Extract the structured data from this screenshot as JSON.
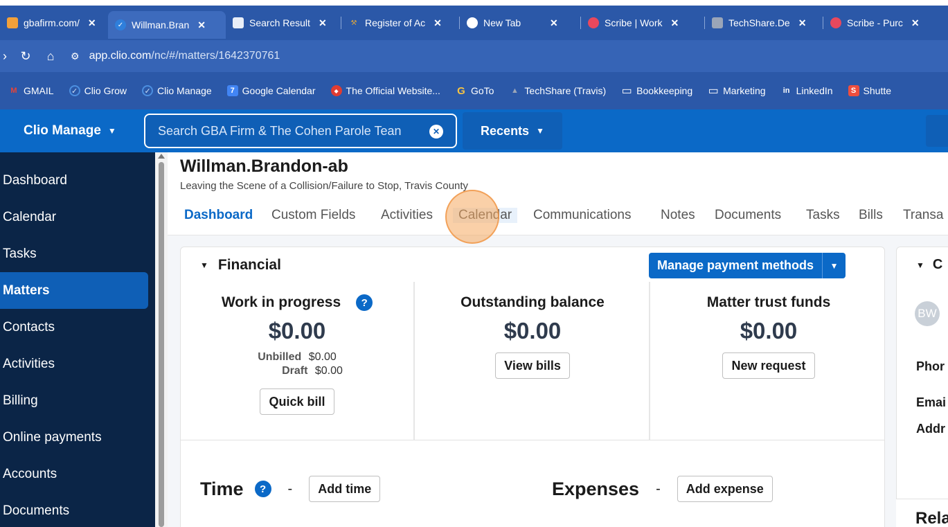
{
  "browser": {
    "tabs": [
      {
        "label": "gbafirm.com/",
        "icon": "generic-favicon",
        "color": "#f2a03a"
      },
      {
        "label": "Willman.Bran",
        "icon": "clio-favicon",
        "color": "#2f7fdb",
        "active": true
      },
      {
        "label": "Search Result",
        "icon": "document-favicon",
        "color": "#e8eef8"
      },
      {
        "label": "Register of Ac",
        "icon": "register-favicon",
        "color": "#d9a441"
      },
      {
        "label": "New Tab",
        "icon": "chrome-icon",
        "color": "#ffffff"
      },
      {
        "label": "Scribe | Work",
        "icon": "scribe-icon",
        "color": "#e8485d"
      },
      {
        "label": "TechShare.De",
        "icon": "courthouse-icon",
        "color": "#9aa5b8"
      },
      {
        "label": "Scribe - Purc",
        "icon": "scribe-icon",
        "color": "#e8485d"
      }
    ],
    "close_glyph": "✕",
    "url_site": "app.clio.com",
    "url_path": "/nc/#/matters/1642370761",
    "bookmarks": [
      {
        "label": "GMAIL",
        "icon": "gmail-icon",
        "glyph": "M",
        "color": "#ea4335"
      },
      {
        "label": "Clio Grow",
        "icon": "clio-grow-icon",
        "glyph": "✓",
        "color": "#4c8fe0"
      },
      {
        "label": "Clio Manage",
        "icon": "clio-manage-icon",
        "glyph": "✓",
        "color": "#4c8fe0"
      },
      {
        "label": "Google Calendar",
        "icon": "google-calendar-icon",
        "glyph": "7",
        "color": "#4285f4"
      },
      {
        "label": "The Official Website...",
        "icon": "official-website-icon",
        "glyph": "◆",
        "color": "#e03c31"
      },
      {
        "label": "GoTo",
        "icon": "goto-icon",
        "glyph": "G",
        "color": "#f6c343"
      },
      {
        "label": "TechShare (Travis)",
        "icon": "courthouse-icon",
        "glyph": "▲",
        "color": "#9aa5b8"
      },
      {
        "label": "Bookkeeping",
        "icon": "folder-icon",
        "glyph": "▭",
        "color": "transparent"
      },
      {
        "label": "Marketing",
        "icon": "folder-icon",
        "glyph": "▭",
        "color": "transparent"
      },
      {
        "label": "LinkedIn",
        "icon": "linkedin-icon",
        "glyph": "in",
        "color": "transparent"
      },
      {
        "label": "Shutte",
        "icon": "shutterstock-icon",
        "glyph": "S",
        "color": "#ee4e3e"
      }
    ]
  },
  "header": {
    "brand": "Clio Manage",
    "search_placeholder": "Search GBA Firm & The Cohen Parole Tean",
    "recents": "Recents"
  },
  "sidebar": {
    "items": [
      {
        "label": "Dashboard"
      },
      {
        "label": "Calendar"
      },
      {
        "label": "Tasks"
      },
      {
        "label": "Matters",
        "active": true
      },
      {
        "label": "Contacts"
      },
      {
        "label": "Activities"
      },
      {
        "label": "Billing"
      },
      {
        "label": "Online payments"
      },
      {
        "label": "Accounts"
      },
      {
        "label": "Documents"
      }
    ]
  },
  "matter": {
    "title": "Willman.Brandon-ab",
    "subtitle": "Leaving the Scene of a Collision/Failure to Stop, Travis County",
    "tabs": [
      "Dashboard",
      "Custom Fields",
      "Activities",
      "Calendar",
      "Communications",
      "Notes",
      "Documents",
      "Tasks",
      "Bills",
      "Transa"
    ]
  },
  "financial": {
    "heading": "Financial",
    "manage_payment": "Manage payment methods",
    "wip": {
      "title": "Work in progress",
      "amount": "$0.00",
      "unbilled_label": "Unbilled",
      "unbilled_value": "$0.00",
      "draft_label": "Draft",
      "draft_value": "$0.00",
      "button": "Quick bill"
    },
    "outstanding": {
      "title": "Outstanding balance",
      "amount": "$0.00",
      "button": "View bills"
    },
    "trust": {
      "title": "Matter trust funds",
      "amount": "$0.00",
      "button": "New request"
    },
    "help_glyph": "?"
  },
  "time": {
    "heading": "Time",
    "dash": "-",
    "button": "Add time"
  },
  "expenses": {
    "heading": "Expenses",
    "dash": "-",
    "button": "Add expense"
  },
  "right_panel": {
    "heading": "C",
    "avatar": "BW",
    "phone": "Phor",
    "email": "Emai",
    "address": "Addr",
    "related": "Rela"
  }
}
